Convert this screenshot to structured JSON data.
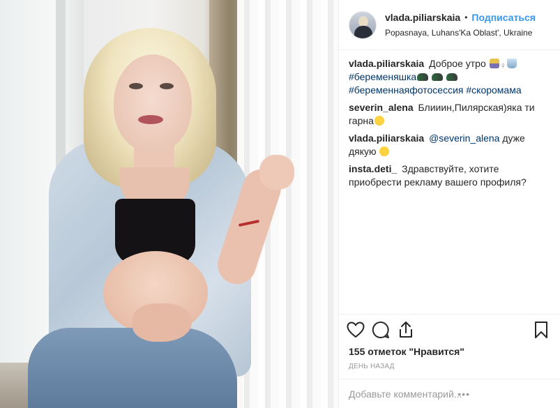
{
  "header": {
    "username": "vlada.piliarskaia",
    "separator": "•",
    "follow_label": "Подписаться",
    "location": "Popasnaya, Luhans'Ka Oblast', Ukraine"
  },
  "comments": [
    {
      "author": "vlada.piliarskaia",
      "text": "Доброе утро",
      "hashtags": [
        "#беременяшка",
        "#беременнаяфотосессия",
        "#скоромама"
      ]
    },
    {
      "author": "severin_alena",
      "text": "Блииин,Пилярская)яка ти гарна"
    },
    {
      "author": "vlada.piliarskaia",
      "mention": "@severin_alena",
      "text": "дуже дякую"
    },
    {
      "author": "insta.deti_",
      "text": "Здравствуйте, хотите приобрести рекламу вашего профиля?"
    }
  ],
  "actions": {
    "icons": [
      "heart-icon",
      "comment-icon",
      "share-icon",
      "bookmark-icon"
    ]
  },
  "stats": {
    "likes": "155 отметок \"Нравится\"",
    "time": "ДЕНЬ НАЗАД"
  },
  "add_comment": {
    "placeholder": "Добавьте комментарий...",
    "more": "•••"
  },
  "colors": {
    "link": "#3897f0",
    "hashtag": "#003569",
    "muted": "#999999"
  }
}
